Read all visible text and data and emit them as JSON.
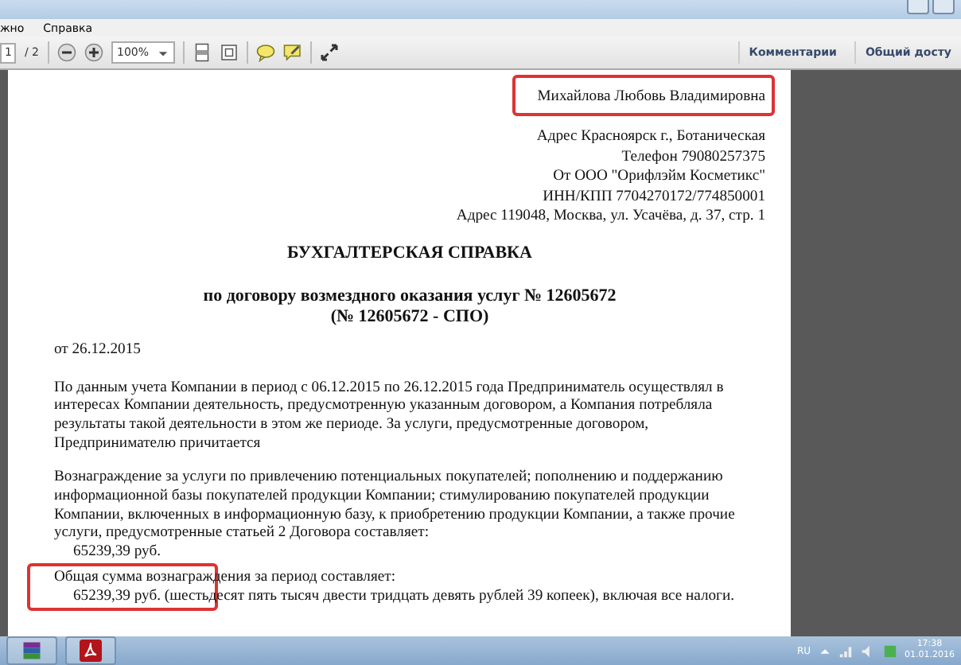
{
  "menu": [
    "жно",
    "Справка"
  ],
  "toolbar": {
    "page": "1",
    "pages": "/ 2",
    "zoom": "100%",
    "right_buttons": [
      "Комментарии",
      "Общий досту"
    ]
  },
  "document": {
    "header": [
      "Михайлова Любовь Владимировна",
      "Адрес Красноярск г., Ботаническая",
      "Телефон 79080257375",
      "От ООО \"Орифлэйм Косметикс\"",
      "ИНН/КПП 7704270172/774850001",
      "Адрес 119048, Москва, ул. Усачёва, д. 37, стр. 1"
    ],
    "title": "БУХГАЛТЕРСКАЯ СПРАВКА",
    "subtitle": [
      "по договору возмездного оказания услуг № 12605672",
      "(№ 12605672 - СПО)"
    ],
    "date": "от 26.12.2015",
    "paragraph_1": "По данным учета Компании в период с 06.12.2015 по 26.12.2015 года Предприниматель осуществлял в интересах Компании деятельность, предусмотренную указанным договором, а Компания потребляла результаты такой деятельности в этом же периоде. За услуги, предусмотренные договором, Предпринимателю причитается",
    "paragraph_2": "Вознаграждение за услуги по привлечению потенциальных покупателей; пополнению и поддержанию информационной базы покупателей продукции Компании; стимулированию  покупателей продукции Компании, включенных в информационную базу, к приобретению продукции Компании, а также прочие услуги, предусмотренные статьей 2 Договора составляет:",
    "amount": "65239,39 руб.",
    "total_label": "Общая сумма вознаграждения за период составляет:",
    "total_value": "65239,39 руб. (шестьдесят пять тысяч двести тридцать девять рублей 39 копеек), включая все налоги."
  },
  "taskbar": {
    "language": "RU",
    "time": "17:38",
    "date": "01.01.2016"
  }
}
